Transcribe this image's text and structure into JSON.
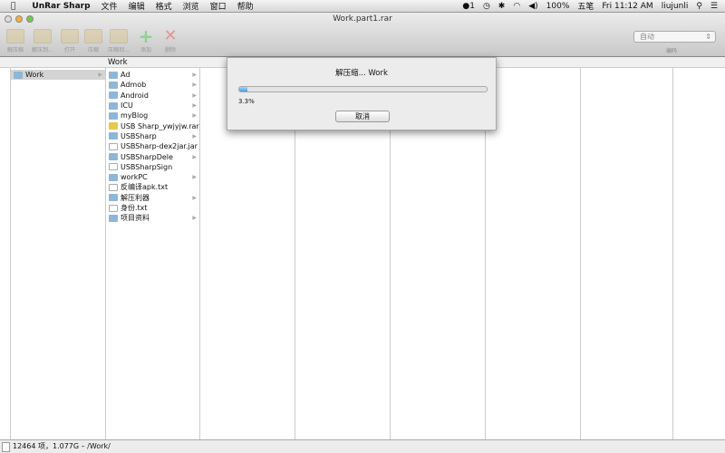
{
  "menubar": {
    "apple": "",
    "app": "UnRar Sharp",
    "items": [
      "文件",
      "编辑",
      "格式",
      "浏览",
      "窗口",
      "帮助"
    ],
    "status": {
      "qq": "1",
      "battery": "100%",
      "ime": "五笔",
      "clock": "Fri 11:12 AM",
      "user": "liujunli"
    }
  },
  "window": {
    "title": "Work.part1.rar"
  },
  "toolbar": {
    "items": [
      "解压缩",
      "解压到...",
      "打开",
      "压缩",
      "压缩到...",
      "添加",
      "删除"
    ],
    "encoding_value": "自动",
    "encoding_label": "编码"
  },
  "browser": {
    "header": "Work",
    "col1": [
      {
        "name": "Work",
        "type": "folder",
        "selected": true
      }
    ],
    "col2": [
      {
        "name": "Ad",
        "type": "folder",
        "arrow": true
      },
      {
        "name": "Admob",
        "type": "folder",
        "arrow": true
      },
      {
        "name": "Android",
        "type": "folder",
        "arrow": true
      },
      {
        "name": "ICU",
        "type": "folder",
        "arrow": true
      },
      {
        "name": "myBlog",
        "type": "folder",
        "arrow": true
      },
      {
        "name": "USB Sharp_ywjyjw.rar",
        "type": "rar",
        "arrow": false
      },
      {
        "name": "USBSharp",
        "type": "folder",
        "arrow": true
      },
      {
        "name": "USBSharp-dex2jar.jar",
        "type": "file",
        "arrow": false
      },
      {
        "name": "USBSharpDele",
        "type": "folder",
        "arrow": true
      },
      {
        "name": "USBSharpSign",
        "type": "file",
        "arrow": false
      },
      {
        "name": "workPC",
        "type": "folder",
        "arrow": true
      },
      {
        "name": "反编译apk.txt",
        "type": "file",
        "arrow": false
      },
      {
        "name": "解压利器",
        "type": "folder",
        "arrow": true
      },
      {
        "name": "身份.txt",
        "type": "file",
        "arrow": false
      },
      {
        "name": "项目资料",
        "type": "folder",
        "arrow": true
      }
    ]
  },
  "status": {
    "text": "12464 项，1.077G – /Work/"
  },
  "dialog": {
    "title": "解压缩... Work",
    "progress_percent": 3.3,
    "progress_text": "3.3%",
    "cancel": "取消"
  }
}
